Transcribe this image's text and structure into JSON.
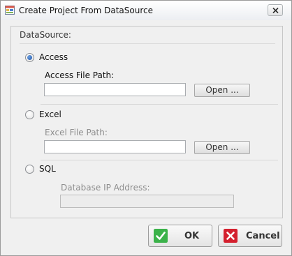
{
  "window": {
    "title": "Create Project From DataSource"
  },
  "group": {
    "title": "DataSource:"
  },
  "options": {
    "access": {
      "label": "Access",
      "selected": true,
      "field_label": "Access File Path:",
      "value": "",
      "open_label": "Open ..."
    },
    "excel": {
      "label": "Excel",
      "selected": false,
      "field_label": "Excel File Path:",
      "value": "",
      "open_label": "Open ..."
    },
    "sql": {
      "label": "SQL",
      "selected": false,
      "field_label": "Database IP Address:",
      "value": ""
    }
  },
  "buttons": {
    "ok_label": "OK",
    "cancel_label": "Cancel"
  },
  "colors": {
    "ok_icon": "#3bb24a",
    "cancel_icon": "#d4202e",
    "radio_selected": "#1e55a8"
  },
  "icons": {
    "app": "app-window-icon",
    "close": "close-icon",
    "ok": "checkmark-icon",
    "cancel": "x-mark-icon"
  }
}
